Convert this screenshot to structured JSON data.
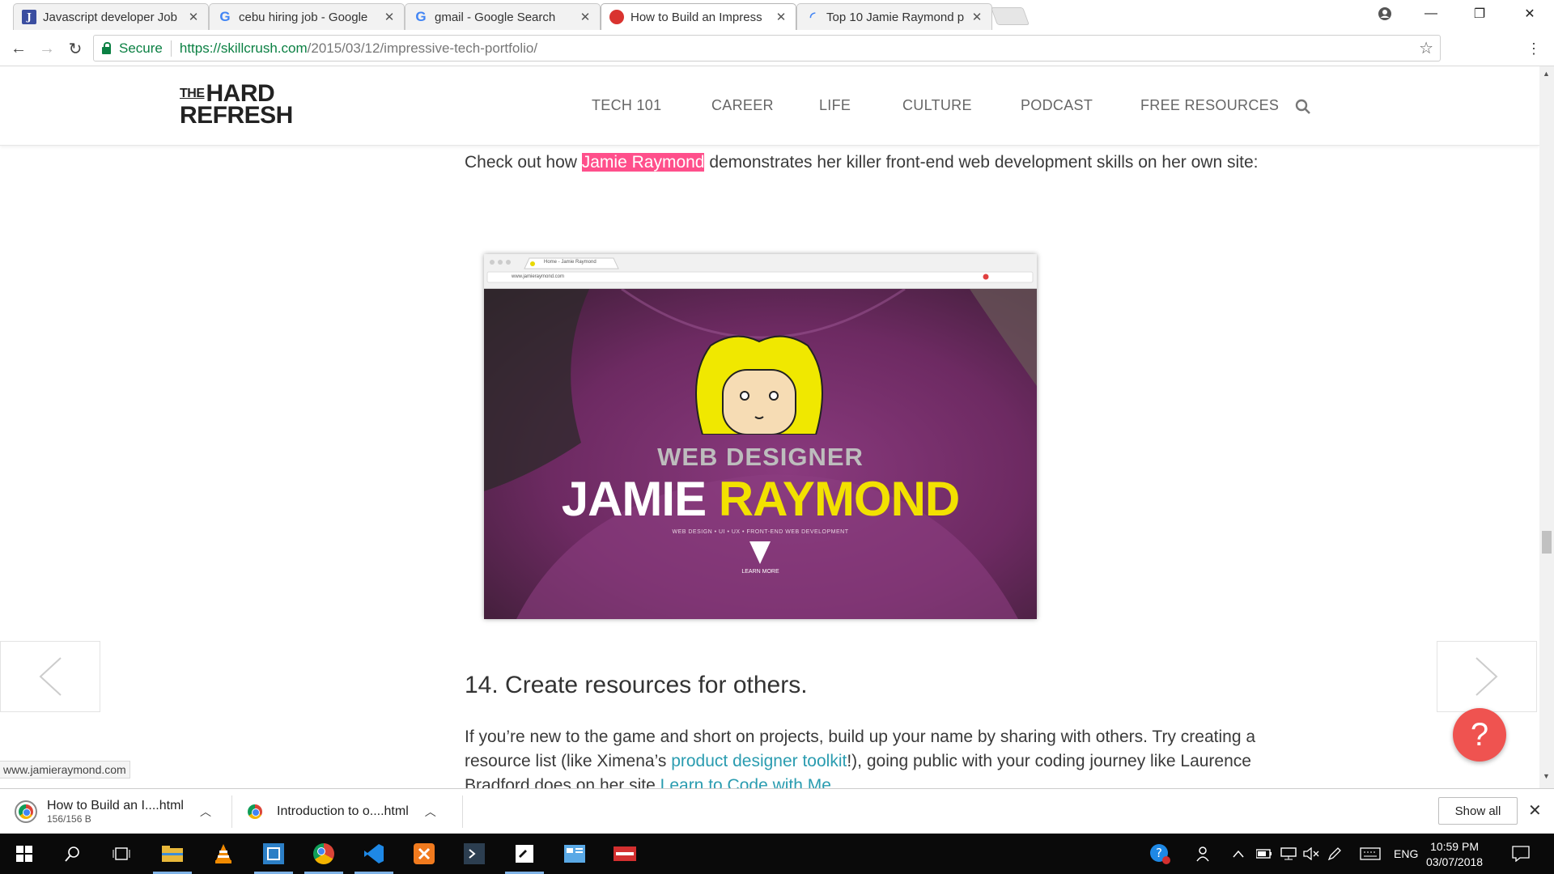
{
  "tabs": [
    {
      "title": "Javascript developer Job",
      "icon": "jobstreet-icon"
    },
    {
      "title": "cebu hiring job - Google",
      "icon": "google-icon"
    },
    {
      "title": "gmail - Google Search",
      "icon": "google-icon"
    },
    {
      "title": "How to Build an Impress",
      "icon": "hard-refresh-icon",
      "active": true
    },
    {
      "title": "Top 10 Jamie Raymond p",
      "icon": "loading-icon"
    }
  ],
  "address": {
    "secure_label": "Secure",
    "url_host": "https://skillcrush.com",
    "url_path": "/2015/03/12/impressive-tech-portfolio/"
  },
  "site": {
    "logo_the": "THE",
    "logo_hard": "HARD",
    "logo_refresh": "REFRESH",
    "nav": [
      "TECH 101",
      "CAREER",
      "LIFE",
      "CULTURE",
      "PODCAST",
      "FREE RESOURCES"
    ]
  },
  "article": {
    "p1_before": "Check out how ",
    "p1_highlight": "Jamie Raymond",
    "p1_after": " demonstrates her killer front-end web development skills on her own site:",
    "shot": {
      "tab_title": "Home - Jamie Raymond",
      "url": "www.jamieraymond.com",
      "role": "WEB DESIGNER",
      "first": "JAMIE",
      "last": "RAYMOND",
      "tagline": "WEB DESIGN  •  UI  •  UX  •  FRONT-END WEB DEVELOPMENT",
      "cta": "LEARN MORE"
    },
    "h2": "14. Create resources for others.",
    "p2_a": "If you’re new to the game and short on projects, build up your name by sharing with others. Try creating a resource list (like Ximena’s ",
    "p2_link1": "product designer toolkit",
    "p2_b": "!), going public with your coding journey like Laurence Bradford does on her site ",
    "p2_link2": "Learn to Code with Me"
  },
  "status_url": "www.jamieraymond.com",
  "help_symbol": "?",
  "downloads": [
    {
      "name": "How to Build an I....html",
      "size": "156/156 B"
    },
    {
      "name": "Introduction to o....html",
      "size": ""
    }
  ],
  "show_all": "Show all",
  "tray": {
    "lang": "ENG",
    "time": "10:59 PM",
    "date": "03/07/2018"
  },
  "colors": {
    "highlight": "#ff4f8b",
    "link": "#2a9cb0",
    "fab": "#ef5350",
    "secure": "#0b8043"
  }
}
